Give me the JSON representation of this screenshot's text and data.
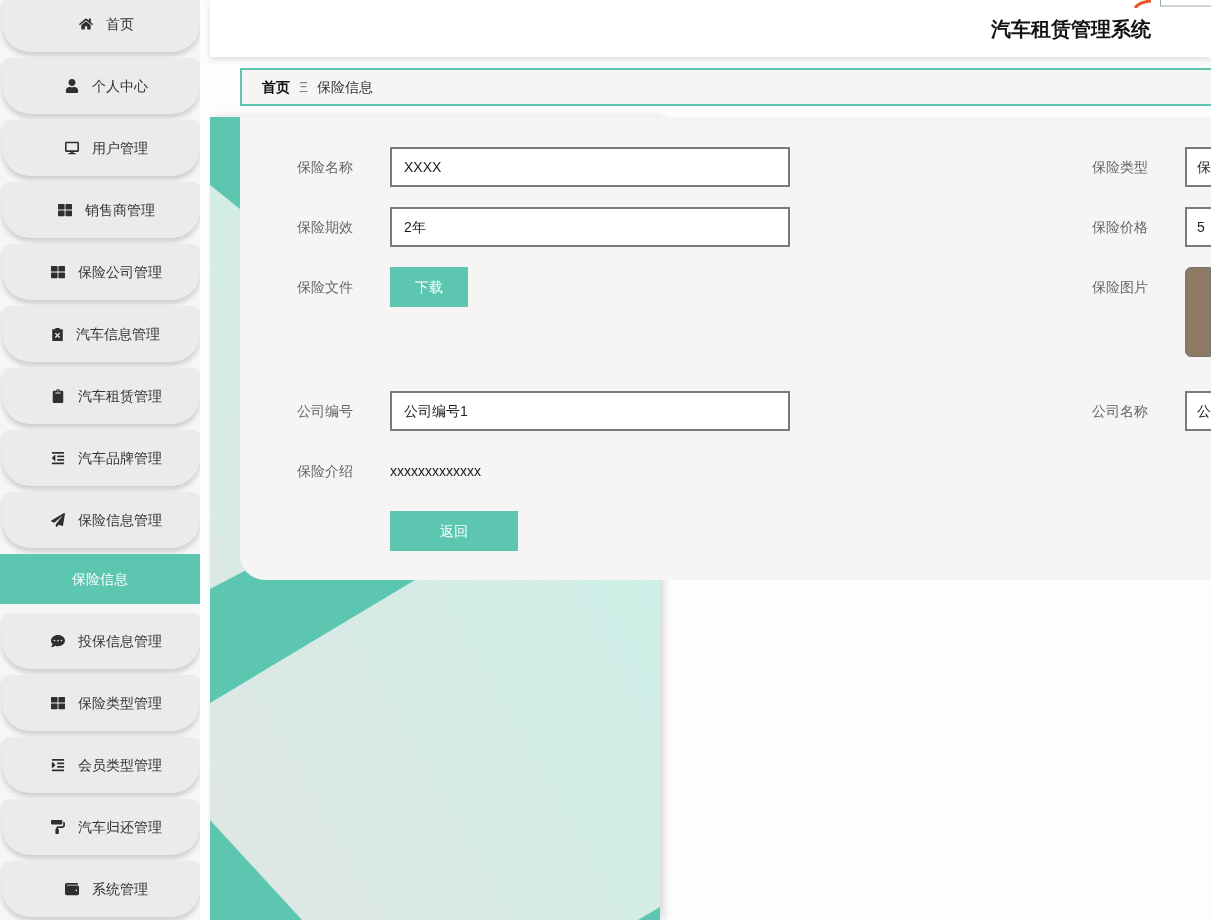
{
  "header": {
    "title": "汽车租赁管理系统"
  },
  "sidebar": {
    "items": [
      {
        "label": "首页",
        "selected": false
      },
      {
        "label": "个人中心",
        "selected": false
      },
      {
        "label": "用户管理",
        "selected": false
      },
      {
        "label": "销售商管理",
        "selected": false
      },
      {
        "label": "保险公司管理",
        "selected": false
      },
      {
        "label": "汽车信息管理",
        "selected": false
      },
      {
        "label": "汽车租赁管理",
        "selected": false
      },
      {
        "label": "汽车品牌管理",
        "selected": false
      },
      {
        "label": "保险信息管理",
        "selected": false,
        "children": [
          {
            "label": "保险信息",
            "selected": true
          }
        ]
      },
      {
        "label": "投保信息管理",
        "selected": false
      },
      {
        "label": "保险类型管理",
        "selected": false
      },
      {
        "label": "会员类型管理",
        "selected": false
      },
      {
        "label": "汽车归还管理",
        "selected": false
      },
      {
        "label": "系统管理",
        "selected": false
      }
    ]
  },
  "breadcrumb": {
    "items": [
      "首页",
      "保险信息"
    ],
    "separator": "Ξ"
  },
  "form": {
    "rows": [
      [
        {
          "label": "保险名称",
          "kind": "input",
          "value": "XXXX"
        },
        {
          "label": "保险类型",
          "kind": "input",
          "value": "保"
        }
      ],
      [
        {
          "label": "保险期效",
          "kind": "input",
          "value": "2年"
        },
        {
          "label": "保险价格",
          "kind": "input",
          "value": "5"
        }
      ],
      [
        {
          "label": "保险文件",
          "kind": "button",
          "button": "下载"
        },
        {
          "label": "保险图片",
          "kind": "image"
        }
      ],
      [
        {
          "label": "公司编号",
          "kind": "input",
          "value": "公司编号1"
        },
        {
          "label": "公司名称",
          "kind": "input",
          "value": "公"
        }
      ],
      [
        {
          "label": "保险介绍",
          "kind": "text",
          "value": "xxxxxxxxxxxxx"
        }
      ]
    ],
    "actions": [
      "返回"
    ]
  }
}
